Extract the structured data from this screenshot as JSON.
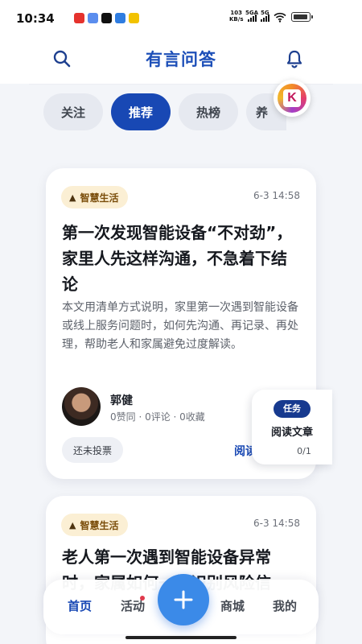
{
  "status_bar": {
    "time": "10:34",
    "net_speed": "103",
    "net_unit": "KB/s",
    "sig1": "5GA",
    "sig2": "5G",
    "app_icon_colors": [
      "#e5322d",
      "#5a8dee",
      "#111111",
      "#2f7de1",
      "#f2c200"
    ]
  },
  "header": {
    "title": "有言问答",
    "search_icon": "search-icon",
    "bell_icon": "bell-icon"
  },
  "tabs": [
    {
      "label": "关注"
    },
    {
      "label": "推荐",
      "active": true
    },
    {
      "label": "热榜"
    },
    {
      "label": "养"
    }
  ],
  "cards": [
    {
      "tag": "智慧生活",
      "date": "6-3 14:58",
      "title": "第一次发现智能设备“不对劲”，家里人先这样沟通，不急着下结论",
      "summary": "本文用清单方式说明，家里第一次遇到智能设备或线上服务问题时，如何先沟通、再记录、再处理，帮助老人和家属避免过度解读。",
      "author": "郭健",
      "stats": "0赞同 · 0评论 · 0收藏",
      "vote_label": "还未投票",
      "read_label": "阅读全文"
    },
    {
      "tag": "智慧生活",
      "date": "6-3 14:58",
      "title": "老人第一次遇到智能设备异常时，家属如何一起识别风险信"
    }
  ],
  "task_widget": {
    "badge": "任务",
    "label": "阅读文章",
    "progress": "0/1"
  },
  "bottom_nav": {
    "items": [
      {
        "label": "首页",
        "active": true
      },
      {
        "label": "活动"
      },
      {
        "label": "商城"
      },
      {
        "label": "我的"
      }
    ],
    "fab_icon": "plus-icon"
  },
  "colors": {
    "primary": "#1848b4",
    "fab": "#3b8ae8",
    "tag_bg": "#fbefd4"
  }
}
